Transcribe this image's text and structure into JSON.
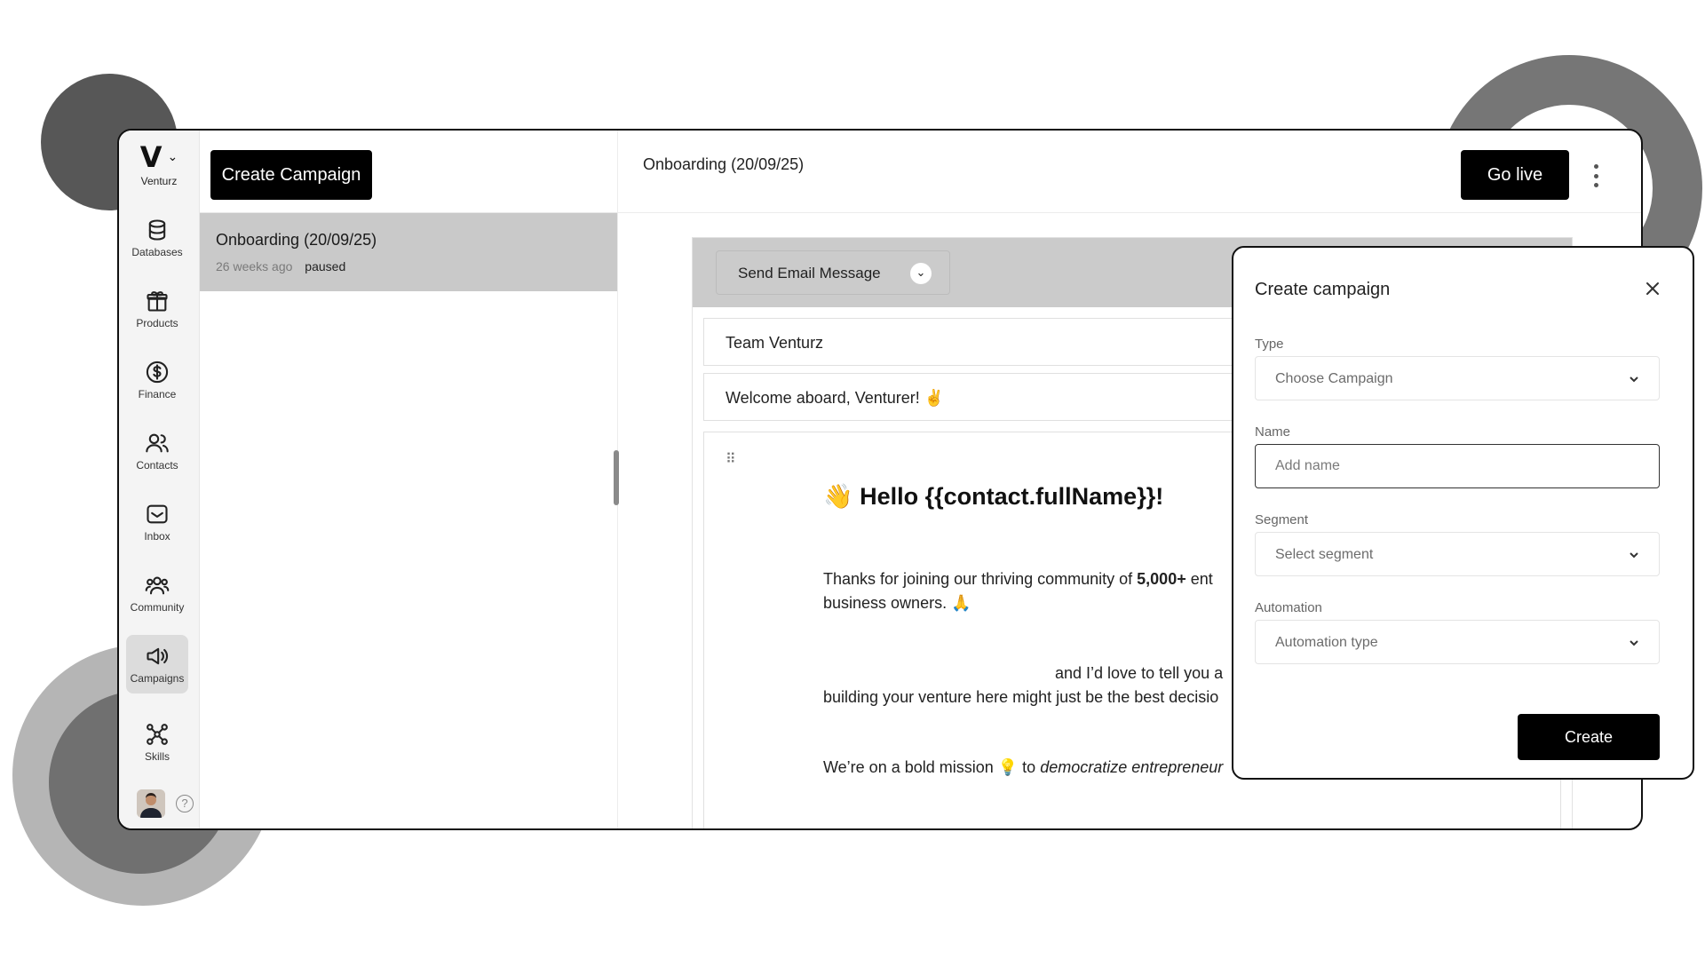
{
  "brand": {
    "name": "Venturz",
    "logo_letter": "V"
  },
  "sidebar": {
    "items": [
      {
        "label": "Databases",
        "icon": "database-icon"
      },
      {
        "label": "Products",
        "icon": "gift-icon"
      },
      {
        "label": "Finance",
        "icon": "dollar-icon"
      },
      {
        "label": "Contacts",
        "icon": "contacts-icon"
      },
      {
        "label": "Inbox",
        "icon": "inbox-icon"
      },
      {
        "label": "Community",
        "icon": "community-icon"
      },
      {
        "label": "Campaigns",
        "icon": "megaphone-icon",
        "active": true
      },
      {
        "label": "Skills",
        "icon": "network-icon"
      }
    ],
    "help_label": "?"
  },
  "campaign_list": {
    "create_label": "Create Campaign",
    "items": [
      {
        "title": "Onboarding (20/09/25)",
        "ago": "26 weeks ago",
        "status": "paused"
      }
    ]
  },
  "main": {
    "title": "Onboarding (20/09/25)",
    "go_live_label": "Go live",
    "editor": {
      "action_label": "Send Email Message",
      "sender": "Team Venturz",
      "subject": "Welcome aboard, Venturer! ✌",
      "greeting": "👋 Hello {{contact.fullName}}!",
      "p1_a": "Thanks for joining our thriving community of ",
      "p1_bold": "5,000+",
      "p1_b": " ent",
      "p1_line2": "business owners. 🙏",
      "p2_line1": "and I’d love to tell you a",
      "p2_line2": "building your venture here might just be the best decisio",
      "p3_a": "We’re on a bold mission 💡 to ",
      "p3_italic": "democratize entrepreneur"
    }
  },
  "modal": {
    "title": "Create campaign",
    "type_label": "Type",
    "type_value": "Choose Campaign",
    "name_label": "Name",
    "name_placeholder": "Add name",
    "segment_label": "Segment",
    "segment_value": "Select segment",
    "automation_label": "Automation",
    "automation_value": "Automation type",
    "create_label": "Create"
  }
}
